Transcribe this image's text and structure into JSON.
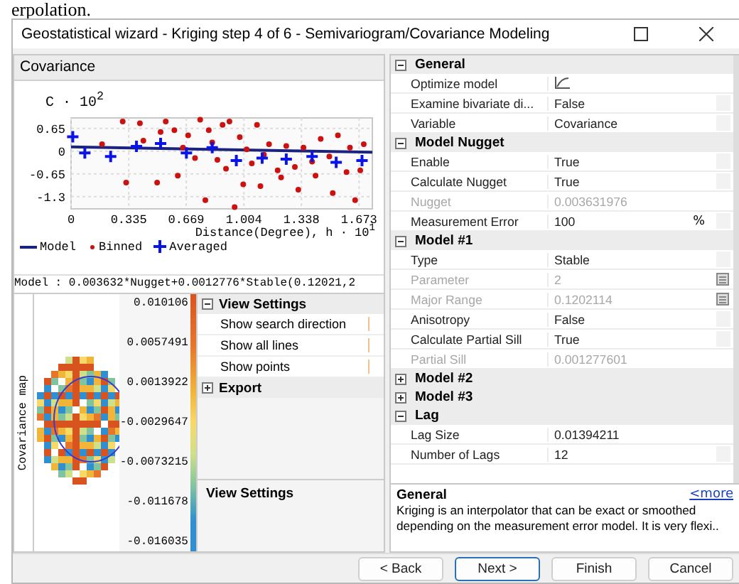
{
  "background_text": "erpolation.",
  "window": {
    "title": "Geostatistical wizard - Kriging step 4 of 6 - Semivariogram/Covariance Modeling"
  },
  "covariance_panel": {
    "title": "Covariance",
    "chart_data": {
      "type": "scatter",
      "ylabel": "C · 10$^{2}$",
      "xlabel": "Distance(Degree), h · 10$^{1}$",
      "xlim": [
        0,
        1.75
      ],
      "ylim": [
        -1.65,
        0.95
      ],
      "xticks": [
        0,
        0.335,
        0.669,
        1.004,
        1.338,
        1.673
      ],
      "yticks": [
        0.65,
        0,
        -0.65,
        -1.3
      ],
      "grid": true,
      "legend": true,
      "series": [
        {
          "name": "Model",
          "color": "#1a237e",
          "type": "line",
          "x": [
            0,
            1.75
          ],
          "values": [
            0.12,
            -0.03
          ]
        },
        {
          "name": "Binned",
          "color": "#cc1111",
          "type": "scatter",
          "x": [
            0.18,
            0.3,
            0.32,
            0.4,
            0.42,
            0.5,
            0.52,
            0.55,
            0.6,
            0.62,
            0.65,
            0.68,
            0.72,
            0.75,
            0.78,
            0.8,
            0.82,
            0.85,
            0.88,
            0.9,
            0.92,
            0.95,
            0.98,
            1.0,
            1.02,
            1.05,
            1.08,
            1.1,
            1.12,
            1.15,
            1.2,
            1.22,
            1.25,
            1.3,
            1.32,
            1.35,
            1.4,
            1.42,
            1.45,
            1.5,
            1.52,
            1.55,
            1.6,
            1.62,
            1.65,
            1.68,
            1.7
          ],
          "values": [
            0.2,
            0.85,
            -0.9,
            0.8,
            0.3,
            -0.9,
            0.55,
            0.85,
            0.6,
            -0.7,
            0.1,
            0.45,
            -0.2,
            0.9,
            -1.4,
            0.6,
            0.25,
            -0.25,
            0.75,
            -0.5,
            0.85,
            -1.6,
            0.4,
            -0.95,
            0.05,
            -0.35,
            0.75,
            -1.0,
            -0.1,
            0.2,
            -0.55,
            -0.75,
            0.15,
            -0.45,
            -1.1,
            0.1,
            -0.3,
            -0.7,
            0.35,
            -0.15,
            -1.2,
            0.45,
            -0.6,
            0.1,
            -1.4,
            -0.55,
            0.2
          ]
        },
        {
          "name": "Averaged",
          "color": "#0a14e6",
          "type": "scatter",
          "x": [
            0.01,
            0.08,
            0.23,
            0.38,
            0.52,
            0.67,
            0.82,
            0.96,
            1.11,
            1.25,
            1.4,
            1.54,
            1.69
          ],
          "values": [
            0.41,
            -0.05,
            -0.15,
            0.14,
            0.22,
            -0.05,
            0.1,
            -0.27,
            -0.2,
            -0.23,
            -0.15,
            -0.32,
            -0.27
          ]
        }
      ]
    },
    "model_formula": "Model : 0.003632*Nugget+0.0012776*Stable(0.12021,2"
  },
  "covariance_map": {
    "label": "Covariance map",
    "scale": [
      "0.010106",
      "0.0057491",
      "0.0013922",
      "-0.0029647",
      "-0.0073215",
      "-0.011678",
      "-0.016035"
    ]
  },
  "view_settings": {
    "groups": [
      {
        "label": "View Settings",
        "expanded": true,
        "children": [
          {
            "label": "Show search direction"
          },
          {
            "label": "Show all lines"
          },
          {
            "label": "Show points"
          }
        ]
      },
      {
        "label": "Export",
        "expanded": false
      }
    ],
    "footer_title": "View Settings"
  },
  "properties": {
    "groups": [
      {
        "label": "General",
        "expanded": true,
        "rows": [
          {
            "name": "Optimize model",
            "kind": "icon",
            "disabled": false
          },
          {
            "name": "Examine bivariate di...",
            "value": "False",
            "kind": "dropdown",
            "disabled": false
          },
          {
            "name": "Variable",
            "value": "Covariance",
            "kind": "dropdown",
            "disabled": false
          }
        ]
      },
      {
        "label": "Model Nugget",
        "expanded": true,
        "rows": [
          {
            "name": "Enable",
            "value": "True",
            "kind": "dropdown",
            "disabled": false
          },
          {
            "name": "Calculate Nugget",
            "value": "True",
            "kind": "dropdown",
            "disabled": false
          },
          {
            "name": "Nugget",
            "value": "0.003631976",
            "kind": "plain",
            "disabled": true
          },
          {
            "name": "Measurement Error",
            "value": "100",
            "unit": "%",
            "kind": "dropdown",
            "disabled": false
          }
        ]
      },
      {
        "label": "Model #1",
        "expanded": true,
        "rows": [
          {
            "name": "Type",
            "value": "Stable",
            "kind": "dropdown",
            "disabled": false
          },
          {
            "name": "Parameter",
            "value": "2",
            "kind": "calculator",
            "disabled": true
          },
          {
            "name": "Major Range",
            "value": "0.1202114",
            "kind": "calculator",
            "disabled": true
          },
          {
            "name": "Anisotropy",
            "value": "False",
            "kind": "dropdown",
            "disabled": false
          },
          {
            "name": "Calculate Partial Sill",
            "value": "True",
            "kind": "dropdown",
            "disabled": false
          },
          {
            "name": "Partial Sill",
            "value": "0.001277601",
            "kind": "plain",
            "disabled": true
          }
        ]
      },
      {
        "label": "Model #2",
        "expanded": false
      },
      {
        "label": "Model #3",
        "expanded": false
      },
      {
        "label": "Lag",
        "expanded": true,
        "rows": [
          {
            "name": "Lag Size",
            "value": "0.01394211",
            "kind": "plain",
            "disabled": false
          },
          {
            "name": "Number of Lags",
            "value": "12",
            "kind": "dropdown",
            "disabled": false
          }
        ]
      }
    ]
  },
  "description": {
    "title": "General",
    "link": "<more",
    "text": "Kriging is an interpolator that can be exact or smoothed depending on the measurement error model. It is very flexi.."
  },
  "buttons": [
    {
      "label": "< Back",
      "selected": false
    },
    {
      "label": "Next >",
      "selected": true
    },
    {
      "label": "Finish",
      "selected": false
    },
    {
      "label": "Cancel",
      "selected": false
    }
  ]
}
